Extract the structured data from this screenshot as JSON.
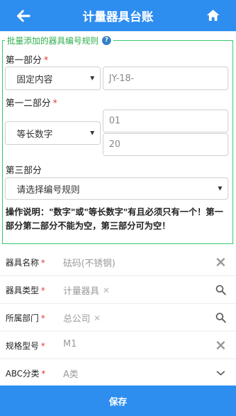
{
  "header": {
    "title": "计量器具台账"
  },
  "rule_section": {
    "legend": "批量添加的器具编号规则",
    "part1": {
      "label": "第一部分",
      "required_mark": "*",
      "select_value": "固定内容",
      "input_value": "JY-18-"
    },
    "part2": {
      "label": "第一二部分",
      "required_mark": "*",
      "select_value": "等长数字",
      "input_start": "01",
      "input_end": "20"
    },
    "part3": {
      "label": "第三部分",
      "select_value": "请选择编号规则"
    },
    "note": "操作说明：\"数字\"或\"等长数字\"有且必须只有一个！第一部分第二部分不能为空，第三部分可为空！"
  },
  "form": {
    "rows": [
      {
        "label": "器具名称",
        "required_mark": "*",
        "value": "砝码(不锈钢)",
        "action_icon": "clear-icon"
      },
      {
        "label": "器具类型",
        "required_mark": "*",
        "value": "计量器具",
        "chip_x": "✕",
        "action_icon": "search-icon"
      },
      {
        "label": "所属部门",
        "required_mark": "*",
        "value": "总公司",
        "chip_x": "✕",
        "action_icon": "search-icon"
      },
      {
        "label": "规格型号",
        "required_mark": "*",
        "value": "M1",
        "action_icon": "clear-icon"
      },
      {
        "label": "ABC分类",
        "required_mark": "*",
        "value": "A类",
        "action_icon": "chevron-down-icon"
      }
    ]
  },
  "footer": {
    "save_label": "保存"
  },
  "colors": {
    "primary": "#2e8ef0",
    "section_border": "#34c86c",
    "required": "#e53935"
  }
}
